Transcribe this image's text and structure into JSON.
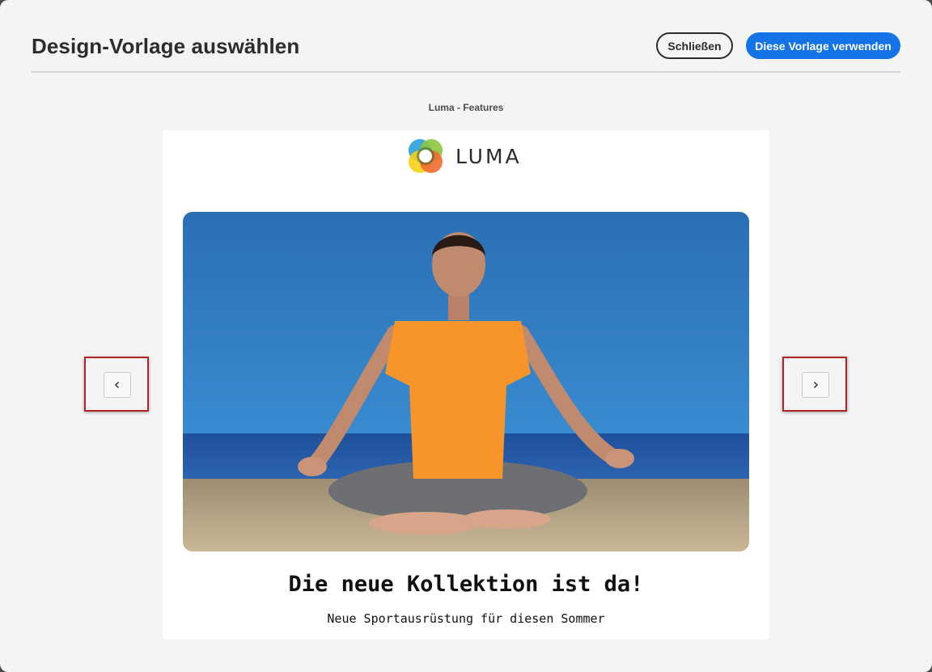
{
  "dialog": {
    "title": "Design-Vorlage auswählen",
    "close_label": "Schließen",
    "use_label": "Diese Vorlage verwenden"
  },
  "preview": {
    "template_name": "Luma - Features",
    "brand_name": "LUMA",
    "headline": "Die neue Kollektion ist da!",
    "subline": "Neue Sportausrüstung für diesen Sommer"
  },
  "navigation": {
    "prev_icon": "chevron-left-icon",
    "next_icon": "chevron-right-icon"
  },
  "colors": {
    "primary": "#1473e6",
    "highlight": "#b32222",
    "background": "#f4f4f4"
  }
}
